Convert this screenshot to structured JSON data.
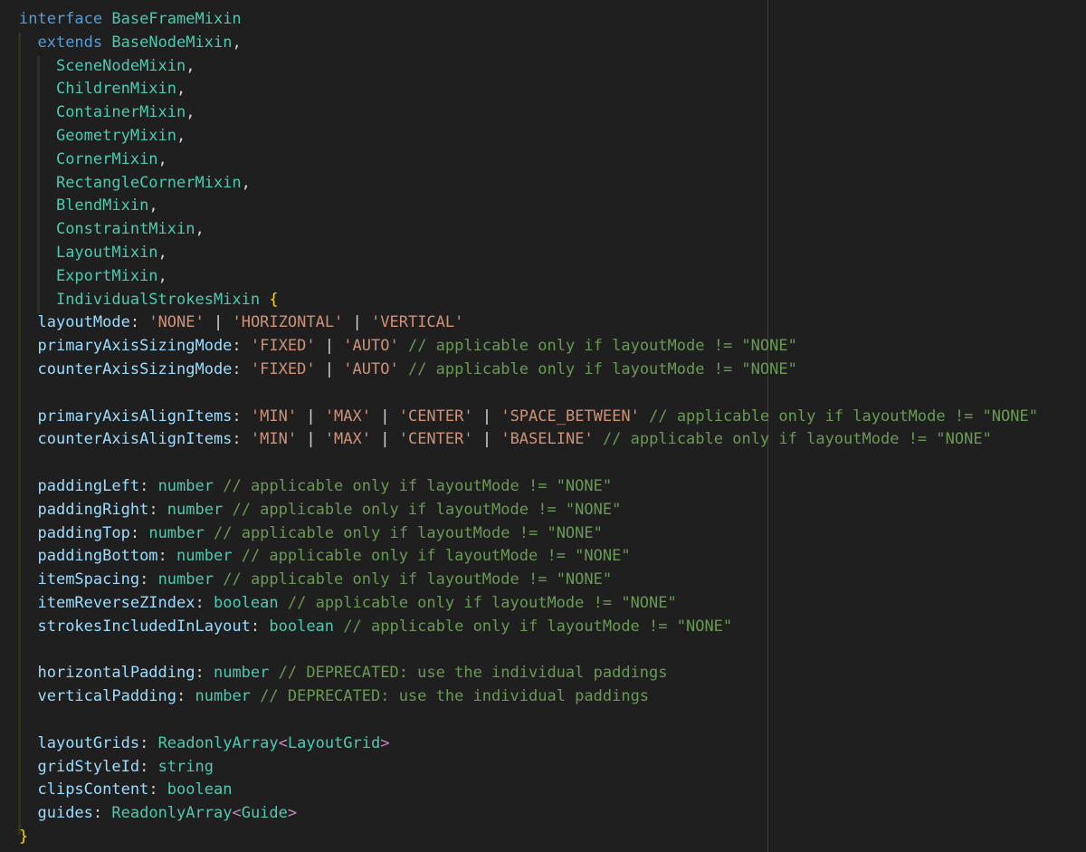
{
  "colors": {
    "background": "#1f1f1f",
    "keyword": "#569cd6",
    "type": "#4ec9b0",
    "property": "#9cdcfe",
    "string": "#ce9178",
    "comment": "#6a9955",
    "brace": "#ffd700"
  },
  "lines": [
    [
      [
        "kw",
        "interface"
      ],
      [
        "punc",
        " "
      ],
      [
        "type",
        "BaseFrameMixin"
      ]
    ],
    [
      [
        "punc",
        "  "
      ],
      [
        "kw",
        "extends"
      ],
      [
        "punc",
        " "
      ],
      [
        "type",
        "BaseNodeMixin"
      ],
      [
        "punc",
        ","
      ]
    ],
    [
      [
        "punc",
        "    "
      ],
      [
        "type",
        "SceneNodeMixin"
      ],
      [
        "punc",
        ","
      ]
    ],
    [
      [
        "punc",
        "    "
      ],
      [
        "type",
        "ChildrenMixin"
      ],
      [
        "punc",
        ","
      ]
    ],
    [
      [
        "punc",
        "    "
      ],
      [
        "type",
        "ContainerMixin"
      ],
      [
        "punc",
        ","
      ]
    ],
    [
      [
        "punc",
        "    "
      ],
      [
        "type",
        "GeometryMixin"
      ],
      [
        "punc",
        ","
      ]
    ],
    [
      [
        "punc",
        "    "
      ],
      [
        "type",
        "CornerMixin"
      ],
      [
        "punc",
        ","
      ]
    ],
    [
      [
        "punc",
        "    "
      ],
      [
        "type",
        "RectangleCornerMixin"
      ],
      [
        "punc",
        ","
      ]
    ],
    [
      [
        "punc",
        "    "
      ],
      [
        "type",
        "BlendMixin"
      ],
      [
        "punc",
        ","
      ]
    ],
    [
      [
        "punc",
        "    "
      ],
      [
        "type",
        "ConstraintMixin"
      ],
      [
        "punc",
        ","
      ]
    ],
    [
      [
        "punc",
        "    "
      ],
      [
        "type",
        "LayoutMixin"
      ],
      [
        "punc",
        ","
      ]
    ],
    [
      [
        "punc",
        "    "
      ],
      [
        "type",
        "ExportMixin"
      ],
      [
        "punc",
        ","
      ]
    ],
    [
      [
        "punc",
        "    "
      ],
      [
        "type",
        "IndividualStrokesMixin"
      ],
      [
        "punc",
        " "
      ],
      [
        "brace",
        "{"
      ]
    ],
    [
      [
        "punc",
        "  "
      ],
      [
        "prop",
        "layoutMode"
      ],
      [
        "punc",
        ": "
      ],
      [
        "str",
        "'NONE'"
      ],
      [
        "punc",
        " | "
      ],
      [
        "str",
        "'HORIZONTAL'"
      ],
      [
        "punc",
        " | "
      ],
      [
        "str",
        "'VERTICAL'"
      ]
    ],
    [
      [
        "punc",
        "  "
      ],
      [
        "prop",
        "primaryAxisSizingMode"
      ],
      [
        "punc",
        ": "
      ],
      [
        "str",
        "'FIXED'"
      ],
      [
        "punc",
        " | "
      ],
      [
        "str",
        "'AUTO'"
      ],
      [
        "punc",
        " "
      ],
      [
        "com",
        "// applicable only if layoutMode != \"NONE\""
      ]
    ],
    [
      [
        "punc",
        "  "
      ],
      [
        "prop",
        "counterAxisSizingMode"
      ],
      [
        "punc",
        ": "
      ],
      [
        "str",
        "'FIXED'"
      ],
      [
        "punc",
        " | "
      ],
      [
        "str",
        "'AUTO'"
      ],
      [
        "punc",
        " "
      ],
      [
        "com",
        "// applicable only if layoutMode != \"NONE\""
      ]
    ],
    [],
    [
      [
        "punc",
        "  "
      ],
      [
        "prop",
        "primaryAxisAlignItems"
      ],
      [
        "punc",
        ": "
      ],
      [
        "str",
        "'MIN'"
      ],
      [
        "punc",
        " | "
      ],
      [
        "str",
        "'MAX'"
      ],
      [
        "punc",
        " | "
      ],
      [
        "str",
        "'CENTER'"
      ],
      [
        "punc",
        " | "
      ],
      [
        "str",
        "'SPACE_BETWEEN'"
      ],
      [
        "punc",
        " "
      ],
      [
        "com",
        "// applicable only if layoutMode != \"NONE\""
      ]
    ],
    [
      [
        "punc",
        "  "
      ],
      [
        "prop",
        "counterAxisAlignItems"
      ],
      [
        "punc",
        ": "
      ],
      [
        "str",
        "'MIN'"
      ],
      [
        "punc",
        " | "
      ],
      [
        "str",
        "'MAX'"
      ],
      [
        "punc",
        " | "
      ],
      [
        "str",
        "'CENTER'"
      ],
      [
        "punc",
        " | "
      ],
      [
        "str",
        "'BASELINE'"
      ],
      [
        "punc",
        " "
      ],
      [
        "com",
        "// applicable only if layoutMode != \"NONE\""
      ]
    ],
    [],
    [
      [
        "punc",
        "  "
      ],
      [
        "prop",
        "paddingLeft"
      ],
      [
        "punc",
        ": "
      ],
      [
        "type",
        "number"
      ],
      [
        "punc",
        " "
      ],
      [
        "com",
        "// applicable only if layoutMode != \"NONE\""
      ]
    ],
    [
      [
        "punc",
        "  "
      ],
      [
        "prop",
        "paddingRight"
      ],
      [
        "punc",
        ": "
      ],
      [
        "type",
        "number"
      ],
      [
        "punc",
        " "
      ],
      [
        "com",
        "// applicable only if layoutMode != \"NONE\""
      ]
    ],
    [
      [
        "punc",
        "  "
      ],
      [
        "prop",
        "paddingTop"
      ],
      [
        "punc",
        ": "
      ],
      [
        "type",
        "number"
      ],
      [
        "punc",
        " "
      ],
      [
        "com",
        "// applicable only if layoutMode != \"NONE\""
      ]
    ],
    [
      [
        "punc",
        "  "
      ],
      [
        "prop",
        "paddingBottom"
      ],
      [
        "punc",
        ": "
      ],
      [
        "type",
        "number"
      ],
      [
        "punc",
        " "
      ],
      [
        "com",
        "// applicable only if layoutMode != \"NONE\""
      ]
    ],
    [
      [
        "punc",
        "  "
      ],
      [
        "prop",
        "itemSpacing"
      ],
      [
        "punc",
        ": "
      ],
      [
        "type",
        "number"
      ],
      [
        "punc",
        " "
      ],
      [
        "com",
        "// applicable only if layoutMode != \"NONE\""
      ]
    ],
    [
      [
        "punc",
        "  "
      ],
      [
        "prop",
        "itemReverseZIndex"
      ],
      [
        "punc",
        ": "
      ],
      [
        "type",
        "boolean"
      ],
      [
        "punc",
        " "
      ],
      [
        "com",
        "// applicable only if layoutMode != \"NONE\""
      ]
    ],
    [
      [
        "punc",
        "  "
      ],
      [
        "prop",
        "strokesIncludedInLayout"
      ],
      [
        "punc",
        ": "
      ],
      [
        "type",
        "boolean"
      ],
      [
        "punc",
        " "
      ],
      [
        "com",
        "// applicable only if layoutMode != \"NONE\""
      ]
    ],
    [],
    [
      [
        "punc",
        "  "
      ],
      [
        "prop",
        "horizontalPadding"
      ],
      [
        "punc",
        ": "
      ],
      [
        "type",
        "number"
      ],
      [
        "punc",
        " "
      ],
      [
        "com",
        "// DEPRECATED: use the individual paddings"
      ]
    ],
    [
      [
        "punc",
        "  "
      ],
      [
        "prop",
        "verticalPadding"
      ],
      [
        "punc",
        ": "
      ],
      [
        "type",
        "number"
      ],
      [
        "punc",
        " "
      ],
      [
        "com",
        "// DEPRECATED: use the individual paddings"
      ]
    ],
    [],
    [
      [
        "punc",
        "  "
      ],
      [
        "prop",
        "layoutGrids"
      ],
      [
        "punc",
        ": "
      ],
      [
        "type",
        "ReadonlyArray"
      ],
      [
        "angle",
        "<"
      ],
      [
        "type",
        "LayoutGrid"
      ],
      [
        "angle",
        ">"
      ]
    ],
    [
      [
        "punc",
        "  "
      ],
      [
        "prop",
        "gridStyleId"
      ],
      [
        "punc",
        ": "
      ],
      [
        "type",
        "string"
      ]
    ],
    [
      [
        "punc",
        "  "
      ],
      [
        "prop",
        "clipsContent"
      ],
      [
        "punc",
        ": "
      ],
      [
        "type",
        "boolean"
      ]
    ],
    [
      [
        "punc",
        "  "
      ],
      [
        "prop",
        "guides"
      ],
      [
        "punc",
        ": "
      ],
      [
        "type",
        "ReadonlyArray"
      ],
      [
        "angle",
        "<"
      ],
      [
        "type",
        "Guide"
      ],
      [
        "angle",
        ">"
      ]
    ],
    [
      [
        "brace",
        "}"
      ]
    ]
  ]
}
